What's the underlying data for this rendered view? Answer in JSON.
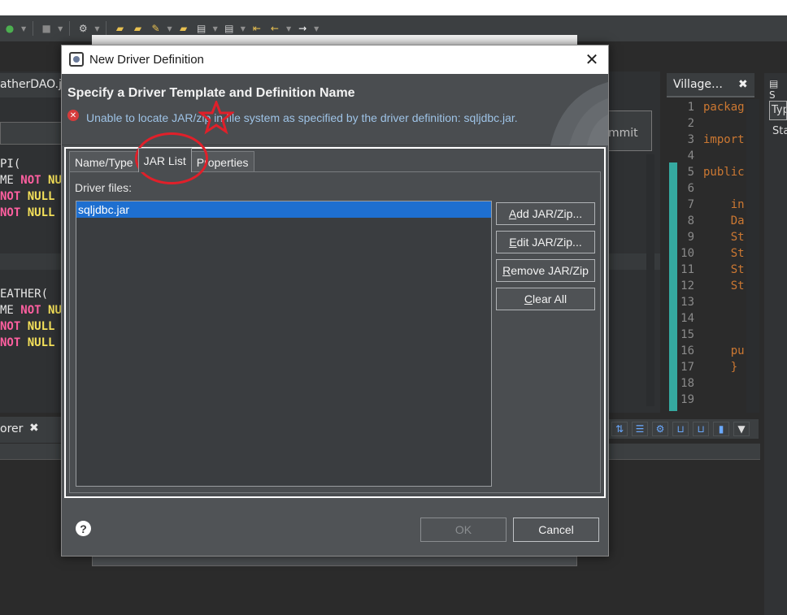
{
  "toolbar": {
    "icons": [
      "run-icon",
      "stop-icon",
      "debug-icon",
      "open-folder-icon",
      "open-folder-icon",
      "pencil-icon",
      "folder-icon",
      "document-icon",
      "document-icon",
      "back-arrow-icon",
      "left-arrow-icon",
      "right-arrow-icon"
    ]
  },
  "background_ide": {
    "left_tab_label": "atherDAO.ja",
    "commit_label": "mmit",
    "code_left": [
      {
        "plain": "PI(",
        "pink": "",
        "yellow": ""
      },
      {
        "plain": "ME ",
        "pink": "NOT",
        "yellow": " NU"
      },
      {
        "plain": "",
        "pink": "NOT",
        "yellow": " NULL"
      },
      {
        "plain": "",
        "pink": "NOT",
        "yellow": " NULL"
      },
      {
        "plain": "EATHER(",
        "pink": "",
        "yellow": ""
      },
      {
        "plain": "ME ",
        "pink": "NOT",
        "yellow": " NU"
      },
      {
        "plain": "",
        "pink": "NOT",
        "yellow": " NULL"
      },
      {
        "plain": "",
        "pink": "NOT",
        "yellow": " NULL"
      }
    ],
    "bottom_tab_label": "orer",
    "bottom_tab_close": "✖",
    "village_tab_label": "Village…",
    "village_tab_close": "✖",
    "line_numbers": "1\n2\n3\n4\n5\n6\n7\n8\n9\n10\n11\n12\n13\n14\n15\n16\n17\n18\n19",
    "code_right": "packag\n\nimport\n\npublic\n\n    in\n    Da\n    St\n    St\n    St\n    St\n\n\n\n    pu\n    }\n\n",
    "far_right_tab": "S",
    "far_right_typ": "Typ",
    "far_right_sta": "Sta"
  },
  "dialog": {
    "title": "New Driver Definition",
    "close_glyph": "✕",
    "header_title": "Specify a Driver Template and Definition Name",
    "error_icon": "✕",
    "error_message": "Unable to locate JAR/zip in file system as specified by the driver definition: sqljdbc.jar.",
    "tabs": [
      {
        "label": "Name/Type",
        "active": false
      },
      {
        "label": "JAR List",
        "active": true
      },
      {
        "label": "Properties",
        "active": false
      }
    ],
    "driver_files_label": "Driver files:",
    "files": [
      "sqljdbc.jar"
    ],
    "buttons": {
      "add": {
        "mnemonic": "A",
        "rest": "dd JAR/Zip..."
      },
      "edit": {
        "mnemonic": "E",
        "rest": "dit JAR/Zip..."
      },
      "remove": {
        "mnemonic": "R",
        "rest": "emove JAR/Zip"
      },
      "clear": {
        "mnemonic": "C",
        "rest": "lear All"
      }
    },
    "help_glyph": "?",
    "ok_label": "OK",
    "cancel_label": "Cancel"
  },
  "colors": {
    "selection": "#1e6fd0",
    "annotation_red": "#e0202a",
    "error_text": "#9ec3e6"
  }
}
